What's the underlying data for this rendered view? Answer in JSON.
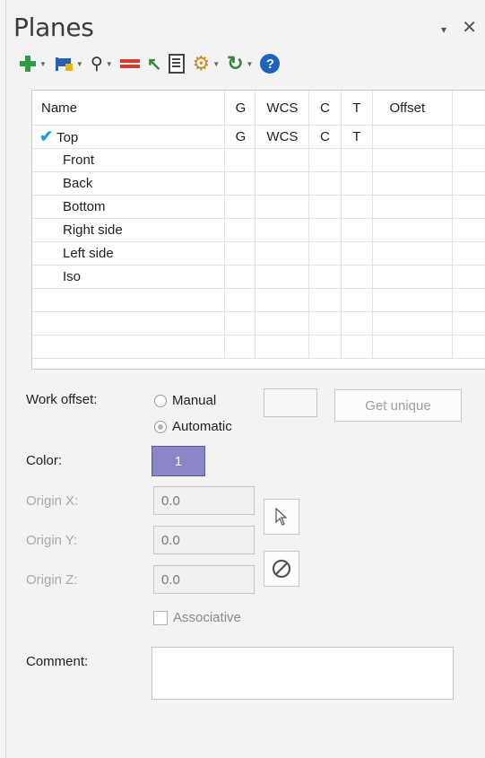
{
  "panel": {
    "title": "Planes",
    "pin_glyph": "▾",
    "close_glyph": "✕"
  },
  "toolbar": {
    "items": [
      {
        "name": "add-plane-icon",
        "has_caret": true
      },
      {
        "name": "flag-icon",
        "has_caret": true
      },
      {
        "name": "find-icon",
        "has_caret": true
      },
      {
        "name": "equal-icon",
        "has_caret": false
      },
      {
        "name": "arrow-up-icon",
        "has_caret": false
      },
      {
        "name": "document-icon",
        "has_caret": false
      },
      {
        "name": "gear-icon",
        "has_caret": true
      },
      {
        "name": "refresh-icon",
        "has_caret": true
      },
      {
        "name": "help-icon",
        "has_caret": false
      }
    ]
  },
  "table": {
    "headers": [
      "Name",
      "G",
      "WCS",
      "C",
      "T",
      "Offset"
    ],
    "rows": [
      {
        "name": "Top",
        "g": "G",
        "wcs": "WCS",
        "c": "C",
        "t": "T",
        "offset": "",
        "checked": true
      },
      {
        "name": "Front",
        "g": "",
        "wcs": "",
        "c": "",
        "t": "",
        "offset": "",
        "checked": false
      },
      {
        "name": "Back",
        "g": "",
        "wcs": "",
        "c": "",
        "t": "",
        "offset": "",
        "checked": false
      },
      {
        "name": "Bottom",
        "g": "",
        "wcs": "",
        "c": "",
        "t": "",
        "offset": "",
        "checked": false
      },
      {
        "name": "Right side",
        "g": "",
        "wcs": "",
        "c": "",
        "t": "",
        "offset": "",
        "checked": false
      },
      {
        "name": "Left side",
        "g": "",
        "wcs": "",
        "c": "",
        "t": "",
        "offset": "",
        "checked": false
      },
      {
        "name": "Iso",
        "g": "",
        "wcs": "",
        "c": "",
        "t": "",
        "offset": "",
        "checked": false
      }
    ],
    "check_glyph": "✔"
  },
  "form": {
    "work_offset_label": "Work offset:",
    "manual_label": "Manual",
    "automatic_label": "Automatic",
    "get_unique_label": "Get unique",
    "color_label": "Color:",
    "color_value": "1",
    "color_hex": "#8b87c6",
    "origin_x_label": "Origin X:",
    "origin_y_label": "Origin Y:",
    "origin_z_label": "Origin Z:",
    "origin_x_value": "0.0",
    "origin_y_value": "0.0",
    "origin_z_value": "0.0",
    "associative_label": "Associative",
    "comment_label": "Comment:",
    "comment_value": ""
  }
}
